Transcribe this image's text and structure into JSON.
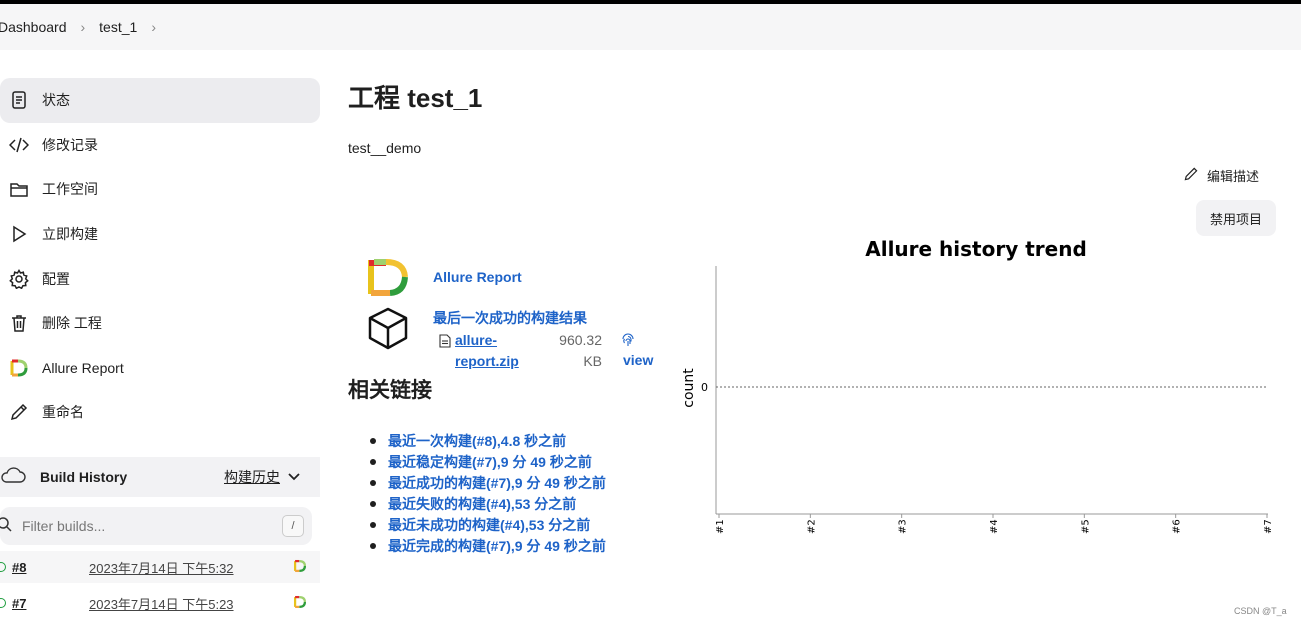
{
  "breadcrumb": [
    "Dashboard",
    "test_1"
  ],
  "sidebar": {
    "items": [
      {
        "label": "状态",
        "icon": "document-icon"
      },
      {
        "label": "修改记录",
        "icon": "code-icon"
      },
      {
        "label": "工作空间",
        "icon": "folder-icon"
      },
      {
        "label": "立即构建",
        "icon": "play-icon"
      },
      {
        "label": "配置",
        "icon": "gear-icon"
      },
      {
        "label": "删除 工程",
        "icon": "trash-icon"
      },
      {
        "label": "Allure Report",
        "icon": "allure-icon"
      },
      {
        "label": "重命名",
        "icon": "pencil-icon"
      }
    ]
  },
  "build_history": {
    "title": "Build History",
    "trend_label": "构建历史",
    "filter_placeholder": "Filter builds...",
    "shortcut": "/",
    "builds": [
      {
        "number": "#8",
        "date": "2023年7月14日 下午5:32"
      },
      {
        "number": "#7",
        "date": "2023年7月14日 下午5:23"
      }
    ]
  },
  "main": {
    "title": "工程 test_1",
    "description": "test__demo",
    "edit_description": "编辑描述",
    "disable_project": "禁用项目",
    "allure_report": "Allure Report",
    "last_success_title": "最后一次成功的构建结果",
    "artifact": {
      "name_line1": "allure-",
      "name_line2": "report.zip",
      "size_line1": "960.32",
      "size_line2": "KB",
      "view": "view"
    },
    "related_title": "相关链接",
    "links": [
      "最近一次构建(#8),4.8 秒之前",
      "最近稳定构建(#7),9 分 49 秒之前",
      "最近成功的构建(#7),9 分 49 秒之前",
      "最近失败的构建(#4),53 分之前",
      "最近未成功的构建(#4),53 分之前",
      "最近完成的构建(#7),9 分 49 秒之前"
    ]
  },
  "chart_data": {
    "type": "line",
    "title": "Allure history trend",
    "ylabel": "count",
    "xlabel": "",
    "categories": [
      "#1",
      "#2",
      "#3",
      "#4",
      "#5",
      "#6",
      "#7"
    ],
    "yticks": [
      "0"
    ],
    "series": []
  },
  "watermark": "CSDN @T_a",
  "colors": {
    "link": "#1e63c8",
    "active_bg": "#ececef",
    "ok": "#1e9e3e"
  }
}
